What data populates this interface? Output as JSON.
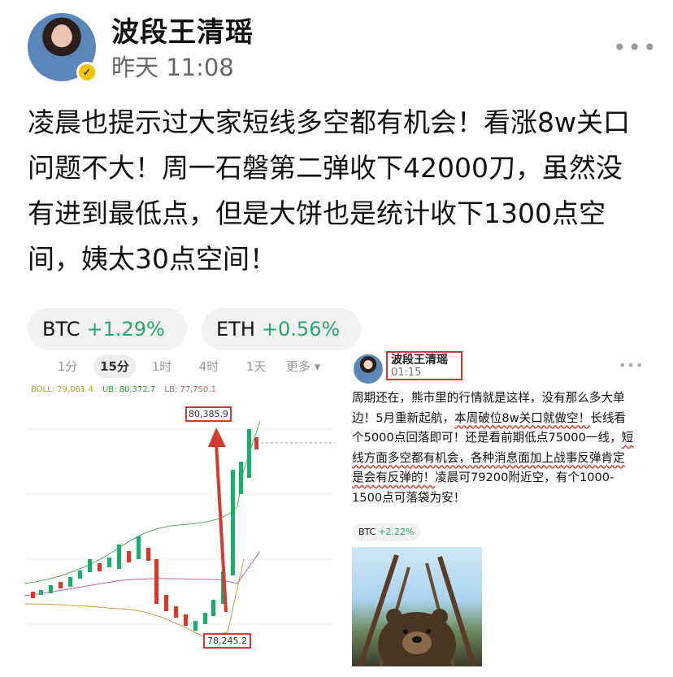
{
  "header": {
    "name": "波段王清瑶",
    "time": "昨天 11:08"
  },
  "post": {
    "text": "凌晨也提示过大家短线多空都有机会！看涨8w关口问题不大！周一石磐第二弹收下42000刀，虽然没有进到最低点，但是大饼也是统计收下1300点空间，姨太30点空间！"
  },
  "tickers": [
    {
      "symbol": "BTC",
      "change": "+1.29%"
    },
    {
      "symbol": "ETH",
      "change": "+0.56%"
    }
  ],
  "chart_tabs": [
    "1分",
    "15分",
    "1时",
    "4时",
    "1天",
    "更多"
  ],
  "boll": {
    "boll": "BOLL: 79,061.4",
    "ub": "UB: 80,372.7",
    "lb": "LB: 77,750.1"
  },
  "chart_labels": {
    "high": "80,385.9",
    "low": "78,245.2"
  },
  "inner_post": {
    "name": "波段王清瑶",
    "time": "01:15",
    "t1": "周期还在，熊市里的行情就是这样，没有那么多大单边！5月重新起航，",
    "t2": "本周破位8w关口就做空！",
    "t3": "长线看个5000点回落即可！还是看前期低点75000一线，",
    "t4": "短线方面多空都有机会，各种消息面加上战事反弹肯定是会有反弹的！",
    "t5": "凌晨可79200附近空，有个1000-1500点可落袋为安！",
    "ticker_symbol": "BTC",
    "ticker_change": "+2.22%"
  },
  "colors": {
    "green": "#24a86b",
    "red": "#d23b2d",
    "badge": "#f5c400"
  }
}
